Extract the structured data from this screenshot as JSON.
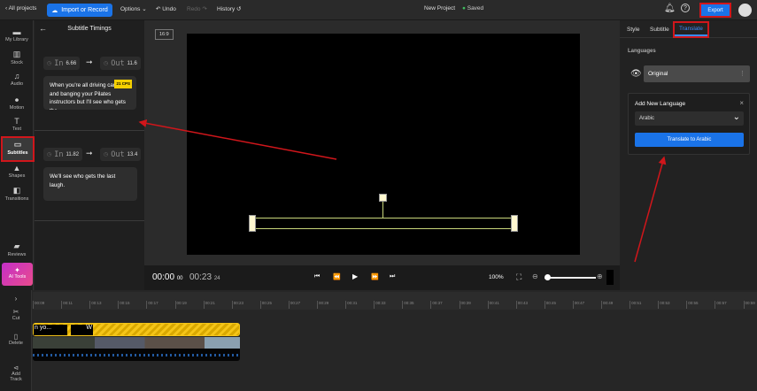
{
  "topbar": {
    "back": "All projects",
    "import": "Import or Record",
    "options": "Options",
    "undo": "Undo",
    "redo": "Redo",
    "history": "History",
    "project": "New Project",
    "saved": "Saved",
    "export": "Export"
  },
  "sidebar": {
    "items": [
      {
        "label": "My Library",
        "icon": "folder-icon",
        "glyph": "▬"
      },
      {
        "label": "Stock",
        "icon": "stock-icon",
        "glyph": "▥"
      },
      {
        "label": "Audio",
        "icon": "music-icon",
        "glyph": "♫"
      },
      {
        "label": "Motion",
        "icon": "motion-icon",
        "glyph": "⦁"
      },
      {
        "label": "Text",
        "icon": "text-icon",
        "glyph": "T"
      },
      {
        "label": "Subtitles",
        "icon": "subtitles-icon",
        "glyph": "▭"
      },
      {
        "label": "Shapes",
        "icon": "shapes-icon",
        "glyph": "▲"
      },
      {
        "label": "Transitions",
        "icon": "transitions-icon",
        "glyph": "◧"
      }
    ],
    "reviews": "Reviews",
    "ai_tools": "AI Tools"
  },
  "subtitles": {
    "title": "Subtitle Timings",
    "in_label": "In",
    "out_label": "Out",
    "items": [
      {
        "in": "6.66",
        "out": "11.6",
        "text": "When you're all driving carpool and banging your Pilates instructors but I'll see who gets the",
        "cps": "21 CPS"
      },
      {
        "in": "11.82",
        "out": "13.4",
        "text": "We'll see who gets the last laugh."
      }
    ]
  },
  "stage": {
    "ratio": "16:9"
  },
  "controls": {
    "current": "00:00",
    "current_frames": "00",
    "total": "00:23",
    "total_frames": "24",
    "zoom": "100%",
    "zoom_slider": 0.05
  },
  "right": {
    "tabs": [
      "Style",
      "Subtitle",
      "Translate"
    ],
    "active_tab": "Translate",
    "languages_label": "Languages",
    "original": "Original",
    "add_title": "Add New Language",
    "language": "Arabic",
    "translate_btn": "Translate to Arabic"
  },
  "timeline": {
    "ruler": [
      "00:09",
      "00:11",
      "00:13",
      "00:15",
      "00:17",
      "00:19",
      "00:21",
      "00:23",
      "00:25",
      "00:27",
      "00:29",
      "00:31",
      "00:33",
      "00:35",
      "00:37",
      "00:39",
      "00:41",
      "00:43",
      "00:45",
      "00:47",
      "00:49",
      "00:51",
      "00:53",
      "00:55",
      "00:57",
      "00:59"
    ],
    "clip1": "n yo...",
    "clip2": "W",
    "tools": {
      "cut": "Cut",
      "delete": "Delete",
      "add_track": "Add Track"
    }
  },
  "colors": {
    "accent": "#1a73e8",
    "annotation": "#d0161b",
    "subtitle_track": "#f5c518"
  }
}
